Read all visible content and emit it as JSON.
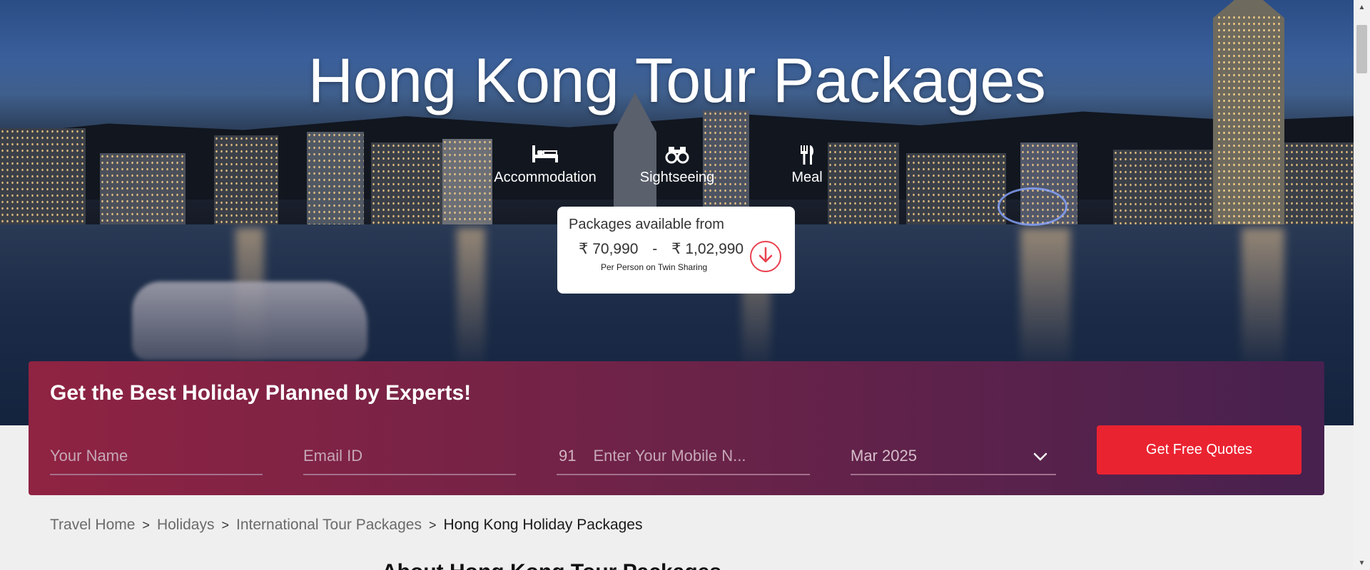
{
  "hero": {
    "title": "Hong Kong Tour Packages",
    "features": [
      {
        "label": "Accommodation",
        "icon": "bed-icon"
      },
      {
        "label": "Sightseeing",
        "icon": "binoculars-icon"
      },
      {
        "label": "Meal",
        "icon": "fork-knife-icon"
      }
    ]
  },
  "price_card": {
    "label": "Packages available from",
    "currency": "₹",
    "min_price": "70,990",
    "separator": "-",
    "max_price": "1,02,990",
    "note": "Per Person on Twin Sharing",
    "down_icon": "arrow-down-icon"
  },
  "lead_form": {
    "title": "Get the Best Holiday Planned by Experts!",
    "name_placeholder": "Your Name",
    "email_placeholder": "Email ID",
    "country_code": "91",
    "mobile_placeholder": "Enter Your Mobile N...",
    "date_value": "Mar 2025",
    "cta_label": "Get Free Quotes",
    "accent_color": "#ea2331"
  },
  "breadcrumb": {
    "items": [
      "Travel Home",
      "Holidays",
      "International Tour Packages"
    ],
    "current": "Hong Kong Holiday Packages",
    "separator": ">"
  },
  "section": {
    "heading": "About Hong Kong Tour Packages"
  }
}
